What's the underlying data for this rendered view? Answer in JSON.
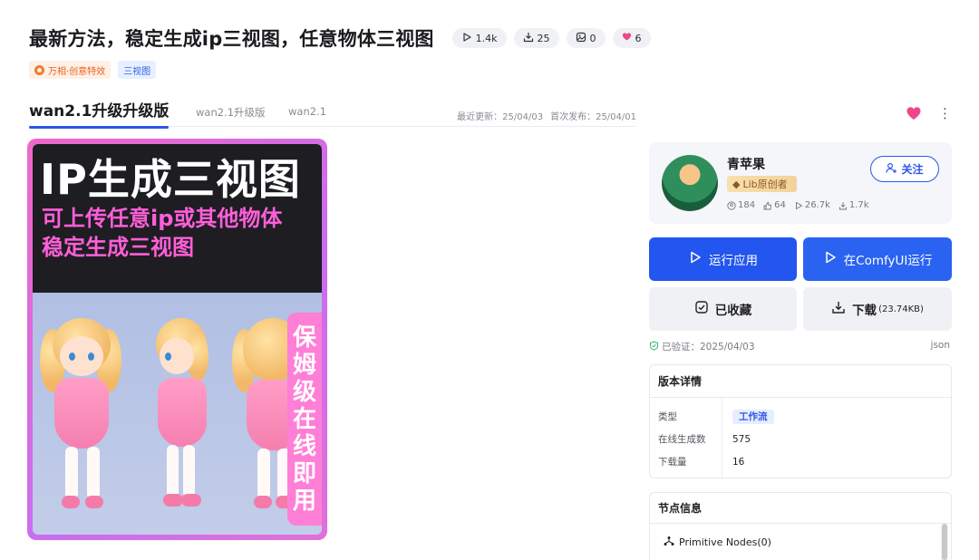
{
  "title": "最新方法，稳定生成ip三视图，任意物体三视图",
  "stats": {
    "runs": "1.4k",
    "downloads": "25",
    "images": "0",
    "likes": "6"
  },
  "tags": [
    {
      "label": "万相·创意特效",
      "color": "#e8641c"
    },
    {
      "label": "三视图",
      "color": "#2f63e8"
    }
  ],
  "versions": {
    "active": "wan2.1升级升级版",
    "others": [
      "wan2.1升级版",
      "wan2.1"
    ]
  },
  "dates": {
    "updated": "最近更新：25/04/03",
    "published": "首次发布：25/04/01"
  },
  "cover": {
    "headline": "IP生成三视图",
    "line1": "可上传任意ip或其他物体",
    "line2": "稳定生成三视图",
    "vertical": [
      "保",
      "姆",
      "级",
      "在",
      "线",
      "即",
      "用"
    ]
  },
  "creator": {
    "name": "青苹果",
    "badge": "Lib原创者",
    "followers": "184",
    "liked": "64",
    "runs": "26.7k",
    "downloads": "1.7k",
    "follow_label": "关注"
  },
  "actions": {
    "run_app": "运行应用",
    "run_comfy": "在ComfyUI运行",
    "collected": "已收藏",
    "download": "下载",
    "download_size": "(23.74KB)"
  },
  "verify": {
    "text": "已验证：2025/04/03",
    "json": "json"
  },
  "version_detail": {
    "title": "版本详情",
    "type_label": "类型",
    "type_value": "工作流",
    "online_label": "在线生成数",
    "online_value": "575",
    "download_label": "下载量",
    "download_value": "16"
  },
  "node_info": {
    "title": "节点信息",
    "item": "Primitive Nodes(0)"
  },
  "colors": {
    "primary": "#2356ee",
    "heart": "#f0468c"
  }
}
